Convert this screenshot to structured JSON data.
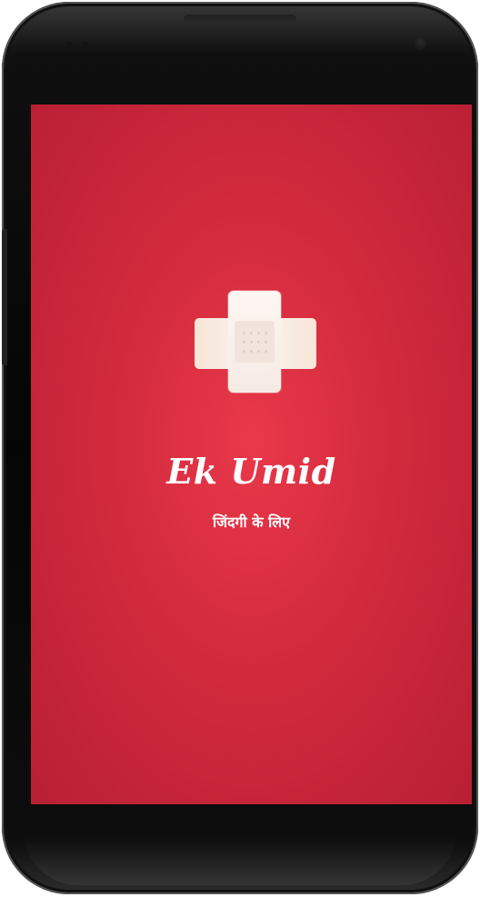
{
  "splash": {
    "app_name": "Ek Umid",
    "tagline": "जिंदगी के लिए",
    "logo_icon": "bandage-cross-icon"
  },
  "colors": {
    "background": "#d22a3d",
    "background_center": "#e9384a",
    "background_edge": "#b81f33",
    "text": "#ffffff",
    "logo": "#f7e6d8"
  }
}
